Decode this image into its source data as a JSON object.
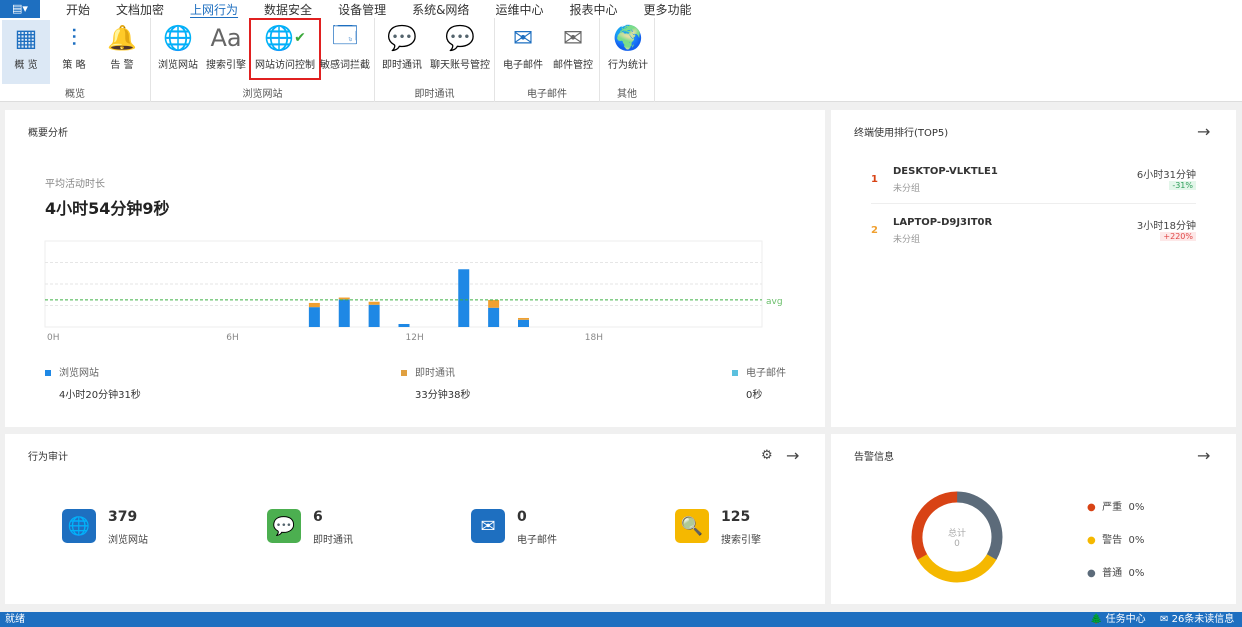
{
  "menubar": {
    "app_icon": "document-menu-icon",
    "items": [
      "开始",
      "文档加密",
      "上网行为",
      "数据安全",
      "设备管理",
      "系统&网络",
      "运维中心",
      "报表中心",
      "更多功能"
    ],
    "active": "上网行为"
  },
  "ribbon": {
    "groups": [
      {
        "label": "概览",
        "buttons": [
          {
            "label": "概 览",
            "icon": "grid-icon"
          },
          {
            "label": "策 略",
            "icon": "sliders-icon"
          },
          {
            "label": "告 警",
            "icon": "bell-icon"
          }
        ]
      },
      {
        "label": "浏览网站",
        "buttons": [
          {
            "label": "浏览网站",
            "icon": "globe-icon"
          },
          {
            "label": "搜索引擎",
            "icon": "font-aa-icon"
          },
          {
            "label": "网站访问控制",
            "icon": "globe-check-icon"
          },
          {
            "label": "敏感词拦截",
            "icon": "window-shield-icon"
          }
        ]
      },
      {
        "label": "即时通讯",
        "buttons": [
          {
            "label": "即时通讯",
            "icon": "chat-icon"
          },
          {
            "label": "聊天账号管控",
            "icon": "chat-user-icon"
          }
        ]
      },
      {
        "label": "电子邮件",
        "buttons": [
          {
            "label": "电子邮件",
            "icon": "envelope-icon"
          },
          {
            "label": "邮件管控",
            "icon": "mail-shield-icon"
          }
        ]
      },
      {
        "label": "其他",
        "buttons": [
          {
            "label": "行为统计",
            "icon": "globe-stats-icon"
          }
        ]
      }
    ]
  },
  "overview": {
    "title": "概要分析",
    "avg_label": "平均活动时长",
    "avg_value": "4小时54分钟9秒",
    "legend": [
      {
        "name": "浏览网站",
        "value": "4小时20分钟31秒",
        "color": "#1e88e5"
      },
      {
        "name": "即时通讯",
        "value": "33分钟38秒",
        "color": "#f0a030"
      },
      {
        "name": "电子邮件",
        "value": "0秒",
        "color": "#5bc0de"
      }
    ]
  },
  "chart_data": {
    "type": "bar",
    "stacked": true,
    "x": [
      9,
      10,
      11,
      12,
      14,
      15,
      16
    ],
    "xticks": [
      "0H",
      "6H",
      "12H",
      "18H"
    ],
    "xlim": [
      0,
      24
    ],
    "ylim": [
      0,
      143
    ],
    "grid": true,
    "series": [
      {
        "name": "浏览网站",
        "values": [
          33,
          46,
          37,
          5,
          96,
          32,
          12
        ]
      },
      {
        "name": "即时通讯",
        "values": [
          7,
          3,
          5,
          0,
          0,
          13,
          3
        ]
      }
    ],
    "avg": {
      "label": "avg",
      "value": 45,
      "color": "#3cb043"
    }
  },
  "top5": {
    "title": "终端使用排行(TOP5)",
    "items": [
      {
        "rank": "1",
        "name": "DESKTOP-VLKTLE1",
        "group": "未分组",
        "time": "6小时31分钟",
        "change": "-31%",
        "trend": "down"
      },
      {
        "rank": "2",
        "name": "LAPTOP-D9J3IT0R",
        "group": "未分组",
        "time": "3小时18分钟",
        "change": "+220%",
        "trend": "up"
      }
    ]
  },
  "audit": {
    "title": "行为审计",
    "stats": [
      {
        "value": "379",
        "label": "浏览网站",
        "icon": "globe-icon",
        "color": "#1e6fc0"
      },
      {
        "value": "6",
        "label": "即时通讯",
        "icon": "chat-icon",
        "color": "#4caf50"
      },
      {
        "value": "0",
        "label": "电子邮件",
        "icon": "envelope-icon",
        "color": "#1e6fc0"
      },
      {
        "value": "125",
        "label": "搜索引擎",
        "icon": "search-icon",
        "color": "#f5b800"
      }
    ]
  },
  "alerts": {
    "title": "告警信息",
    "total_label": "总计",
    "total_value": "0",
    "legend": [
      {
        "name": "严重",
        "value": "0%",
        "color": "#d84315"
      },
      {
        "name": "警告",
        "value": "0%",
        "color": "#f5b800"
      },
      {
        "name": "普通",
        "value": "0%",
        "color": "#5c6b7a"
      }
    ]
  },
  "status": {
    "left": "就绪",
    "task_center": "任务中心",
    "unread": "26条未读信息"
  }
}
